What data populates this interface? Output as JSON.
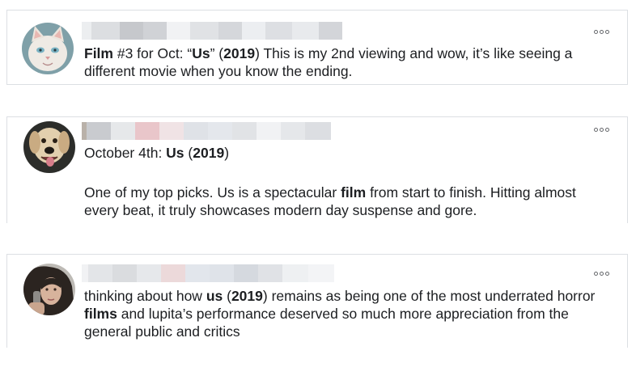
{
  "posts": [
    {
      "segments": [
        {
          "text": "Film",
          "bold": true
        },
        {
          "text": " #3 for Oct: “",
          "bold": false
        },
        {
          "text": "Us",
          "bold": true
        },
        {
          "text": "” (",
          "bold": false
        },
        {
          "text": "2019",
          "bold": true
        },
        {
          "text": ") This is my 2nd viewing and wow, it’s like seeing a different movie when you know the ending.",
          "bold": false
        }
      ],
      "avatar_icon": "cat-avatar-icon",
      "more_icon": "more-options-icon"
    },
    {
      "date_segments": [
        {
          "text": "October 4th: ",
          "bold": false
        },
        {
          "text": "Us",
          "bold": true
        },
        {
          "text": " (",
          "bold": false
        },
        {
          "text": "2019",
          "bold": true
        },
        {
          "text": ")",
          "bold": false
        }
      ],
      "segments": [
        {
          "text": "One of my top picks. Us is a spectacular ",
          "bold": false
        },
        {
          "text": "film",
          "bold": true
        },
        {
          "text": " from start to finish. Hitting almost every beat, it truly showcases modern day suspense and gore.",
          "bold": false
        }
      ],
      "avatar_icon": "dog-avatar-icon",
      "more_icon": "more-options-icon"
    },
    {
      "segments": [
        {
          "text": "thinking about how ",
          "bold": false
        },
        {
          "text": "us",
          "bold": true
        },
        {
          "text": " (",
          "bold": false
        },
        {
          "text": "2019",
          "bold": true
        },
        {
          "text": ") remains as being one of the most underrated horror ",
          "bold": false
        },
        {
          "text": "films",
          "bold": true
        },
        {
          "text": " and lupita’s performance deserved so much more appreciation from the general public and critics",
          "bold": false
        }
      ],
      "avatar_icon": "person-avatar-icon",
      "more_icon": "more-options-icon"
    }
  ],
  "colors": {
    "text": "#1c1e21",
    "border": "#dcdfe3",
    "blur_tones": [
      "#e4e6e9",
      "#d2d4d8",
      "#edeef0",
      "#c9cbcf",
      "#e9c9cc",
      "#dfe3ea"
    ]
  }
}
